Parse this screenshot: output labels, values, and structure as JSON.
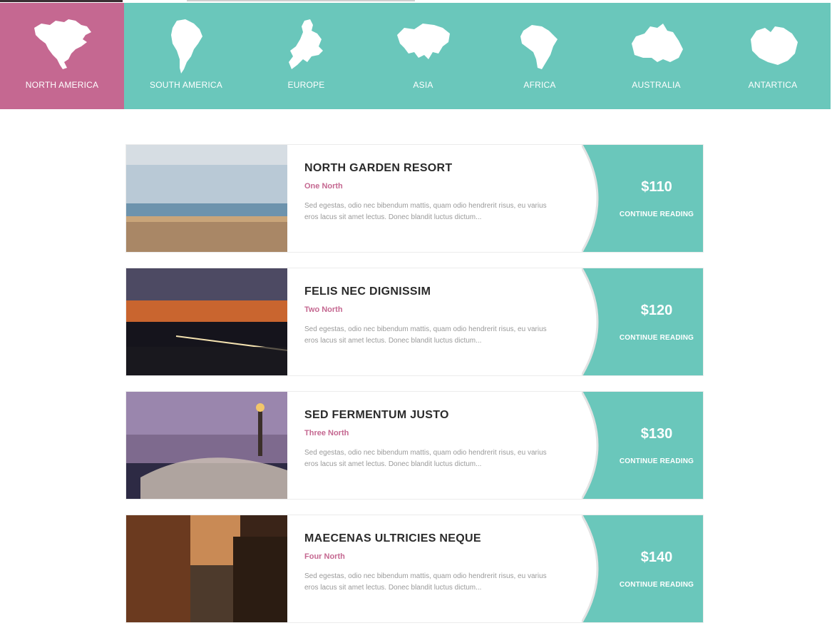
{
  "theme": {
    "teal": "#6ac7bb",
    "pink": "#c56891"
  },
  "nav": {
    "items": [
      {
        "label": "NORTH AMERICA",
        "icon": "north-america-map-icon",
        "active": true
      },
      {
        "label": "SOUTH AMERICA",
        "icon": "south-america-map-icon",
        "active": false
      },
      {
        "label": "EUROPE",
        "icon": "europe-map-icon",
        "active": false
      },
      {
        "label": "ASIA",
        "icon": "asia-map-icon",
        "active": false
      },
      {
        "label": "AFRICA",
        "icon": "africa-map-icon",
        "active": false
      },
      {
        "label": "AUSTRALIA",
        "icon": "australia-map-icon",
        "active": false
      },
      {
        "label": "ANTARTICA",
        "icon": "antarctica-map-icon",
        "active": false
      }
    ]
  },
  "listings": [
    {
      "title": "NORTH GARDEN RESORT",
      "subtitle": "One North",
      "excerpt": "Sed egestas, odio nec bibendum mattis, quam odio hendrerit risus, eu varius eros lacus sit amet lectus. Donec blandit luctus dictum...",
      "price": "$110",
      "cta": "CONTINUE READING",
      "image": "beach-photo"
    },
    {
      "title": "FELIS NEC DIGNISSIM",
      "subtitle": "Two North",
      "excerpt": "Sed egestas, odio nec bibendum mattis, quam odio hendrerit risus, eu varius eros lacus sit amet lectus. Donec blandit luctus dictum...",
      "price": "$120",
      "cta": "CONTINUE READING",
      "image": "bridge-sunset-photo"
    },
    {
      "title": "SED FERMENTUM JUSTO",
      "subtitle": "Three North",
      "excerpt": "Sed egestas, odio nec bibendum mattis, quam odio hendrerit risus, eu varius eros lacus sit amet lectus. Donec blandit luctus dictum...",
      "price": "$130",
      "cta": "CONTINUE READING",
      "image": "paris-bridge-photo"
    },
    {
      "title": "MAECENAS ULTRICIES NEQUE",
      "subtitle": "Four North",
      "excerpt": "Sed egestas, odio nec bibendum mattis, quam odio hendrerit risus, eu varius eros lacus sit amet lectus. Donec blandit luctus dictum...",
      "price": "$140",
      "cta": "CONTINUE READING",
      "image": "canal-evening-photo"
    }
  ]
}
